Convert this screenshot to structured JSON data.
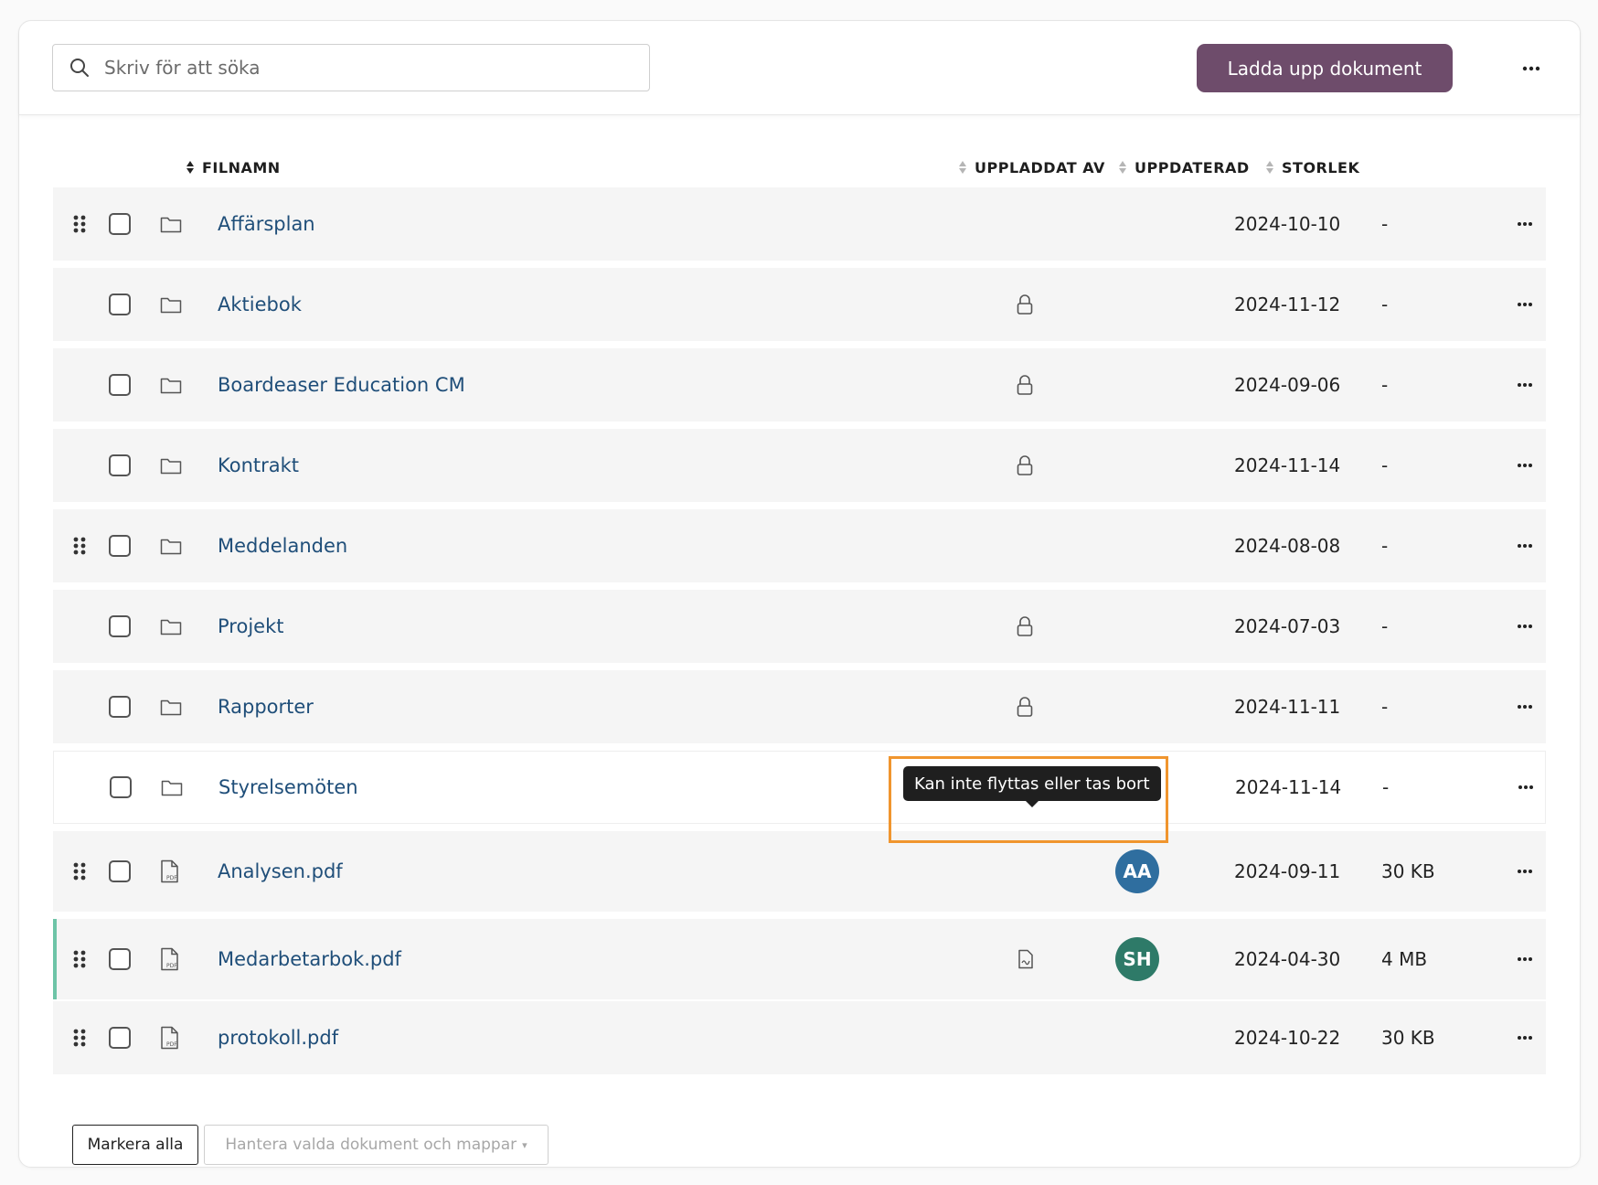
{
  "search": {
    "placeholder": "Skriv för att söka",
    "icon": "search-icon"
  },
  "toolbar": {
    "upload_label": "Ladda upp dokument",
    "upload_color": "#6e4c6b"
  },
  "columns": {
    "filename": "FILNAMN",
    "uploaded_by": "UPPLADDAT AV",
    "updated": "UPPDATERAD",
    "size": "STORLEK"
  },
  "rows": [
    {
      "name": "Affärsplan",
      "type": "folder",
      "draggable": true,
      "locked": false,
      "date": "2024-10-10",
      "size": "-"
    },
    {
      "name": "Aktiebok",
      "type": "folder",
      "draggable": false,
      "locked": true,
      "date": "2024-11-12",
      "size": "-"
    },
    {
      "name": "Boardeaser Education CM",
      "type": "folder",
      "draggable": false,
      "locked": true,
      "date": "2024-09-06",
      "size": "-"
    },
    {
      "name": "Kontrakt",
      "type": "folder",
      "draggable": false,
      "locked": true,
      "date": "2024-11-14",
      "size": "-"
    },
    {
      "name": "Meddelanden",
      "type": "folder",
      "draggable": true,
      "locked": false,
      "date": "2024-08-08",
      "size": "-"
    },
    {
      "name": "Projekt",
      "type": "folder",
      "draggable": false,
      "locked": true,
      "date": "2024-07-03",
      "size": "-"
    },
    {
      "name": "Rapporter",
      "type": "folder",
      "draggable": false,
      "locked": true,
      "date": "2024-11-11",
      "size": "-"
    },
    {
      "name": "Styrelsemöten",
      "type": "folder",
      "draggable": false,
      "locked": true,
      "date": "2024-11-14",
      "size": "-",
      "hovered": true
    },
    {
      "name": "Analysen.pdf",
      "type": "pdf",
      "draggable": true,
      "uploader": "AA",
      "uploader_color": "#2f6e9f",
      "date": "2024-09-11",
      "size": "30 KB"
    },
    {
      "name": "Medarbetarbok.pdf",
      "type": "pdf",
      "draggable": true,
      "signed_doc_icon": true,
      "uploader": "SH",
      "uploader_color": "#2e7a68",
      "date": "2024-04-30",
      "size": "4 MB",
      "accent": "#6ec4a7"
    },
    {
      "name": "protokoll.pdf",
      "type": "pdf",
      "draggable": true,
      "date": "2024-10-22",
      "size": "30 KB"
    }
  ],
  "tooltip": {
    "text": "Kan inte flyttas eller tas bort",
    "highlight_color": "#f0952e"
  },
  "footer": {
    "select_all": "Markera alla",
    "manage": "Hantera valda dokument och mappar"
  }
}
